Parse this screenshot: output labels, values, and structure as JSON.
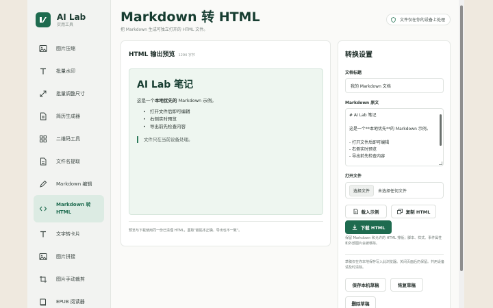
{
  "brand": {
    "title": "AI Lab",
    "subtitle": "实用工具"
  },
  "nav": [
    {
      "label": "图片压缩",
      "icon": "image-icon"
    },
    {
      "label": "批量水印",
      "icon": "text-icon"
    },
    {
      "label": "批量调整尺寸",
      "icon": "resize-icon"
    },
    {
      "label": "简历生成器",
      "icon": "document-icon"
    },
    {
      "label": "二维码工具",
      "icon": "grid-icon"
    },
    {
      "label": "文件名提取",
      "icon": "file-icon"
    },
    {
      "label": "Markdown 编辑",
      "icon": "pencil-icon"
    },
    {
      "label": "Markdown 转 HTML",
      "icon": "code-icon",
      "active": true
    },
    {
      "label": "文字转卡片",
      "icon": "text-icon"
    },
    {
      "label": "图片拼接",
      "icon": "image-icon"
    },
    {
      "label": "图片手动裁剪",
      "icon": "crop-icon"
    },
    {
      "label": "EPUB 阅读器",
      "icon": "book-icon"
    }
  ],
  "header": {
    "title": "Markdown 转 HTML",
    "subtitle": "把 Markdown 生成可独立打开的 HTML 文件。",
    "privacy": "文件仅在你的设备上处理"
  },
  "preview": {
    "title": "HTML 输出预览",
    "count": "1294 字节",
    "h1": "AI Lab 笔记",
    "p_prefix": "这是一个",
    "p_bold": "本地优先的",
    "p_suffix": " Markdown 示例。",
    "list": [
      "打开文件后即可编辑",
      "右侧实时预览",
      "导出前先检查内容"
    ],
    "quote": "文件只在当前设备处理。",
    "footer": "预览与下载使用同一份已清理 HTML，虽取\"最贴本正确、导出也不一致\"。"
  },
  "settings": {
    "title": "转换设置",
    "doc_title_label": "文档标题",
    "doc_title_value": "我的 Markdown 文档",
    "source_label": "Markdown 原文",
    "source_lines": [
      "# AI Lab 笔记",
      "",
      "这是一个**本地优先**的 Markdown 示例。",
      "",
      "- 打开文件后即可编辑",
      "- 右侧实时预览",
      "- 导出前先检查内容"
    ],
    "open_file_label": "打开文件",
    "choose_file": "选择文件",
    "no_file": "未选择任何文件",
    "load_example": "载入示例",
    "copy_html": "复制 HTML",
    "download_html": "下载 HTML",
    "note1": "保留 Markdown 和允许的 HTML 排版；脚本、样式、事件属性和外部图片会被移除。",
    "note2": "草稿仅在你本地保存写入此浏览器。关闭页面后仍保留。共用设备请及时清除。",
    "save_draft": "保存本机草稿",
    "restore_draft": "恢复草稿",
    "delete_draft": "删除草稿"
  }
}
